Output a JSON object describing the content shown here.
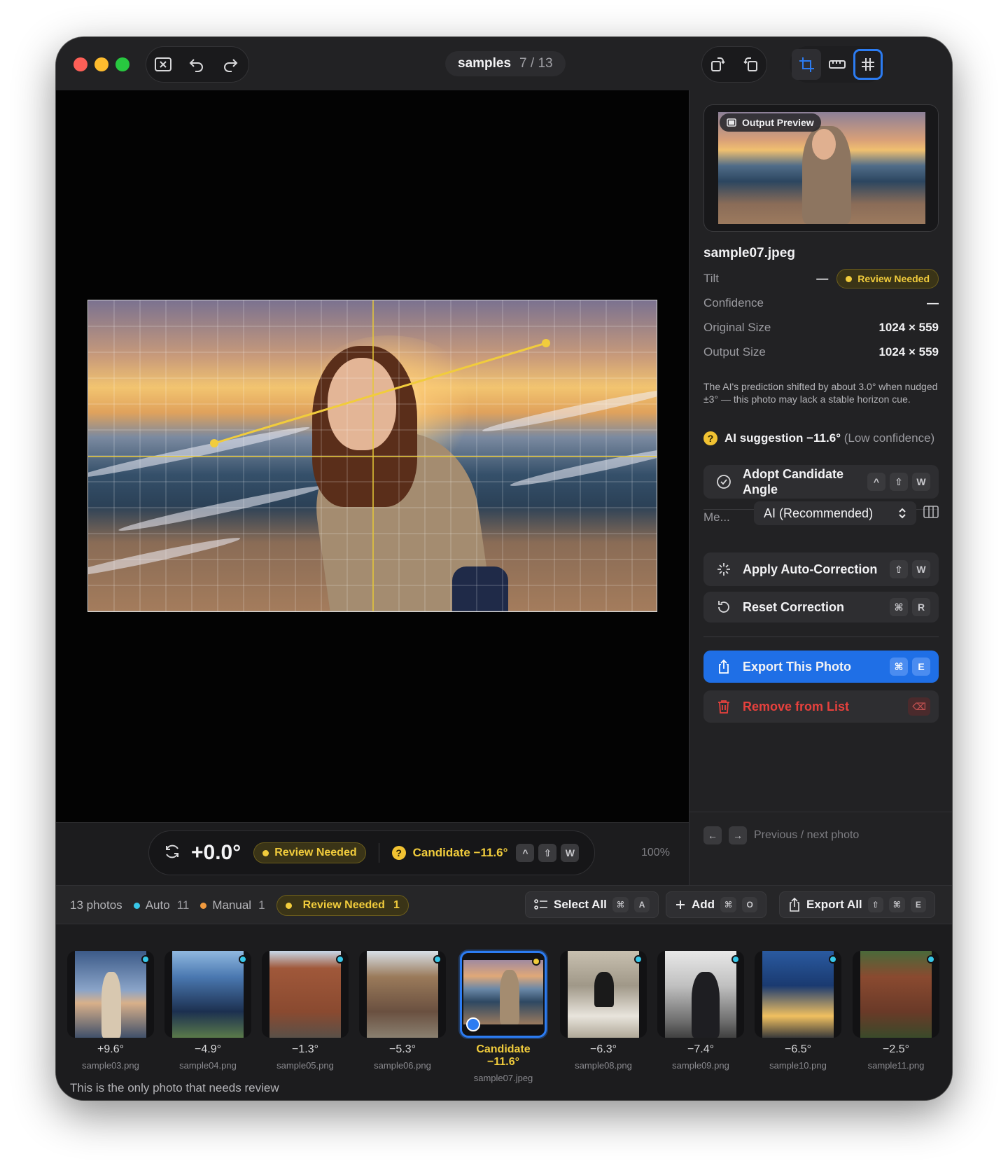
{
  "window": {
    "title": "samples",
    "counter": "7 / 13"
  },
  "canvas": {
    "angle_value": "+0.0°",
    "review_badge": "Review Needed",
    "candidate_label": "Candidate −11.6°",
    "candidate_keys": [
      "^",
      "⇧",
      "W"
    ],
    "zoom": "100%"
  },
  "side": {
    "preview_badge": "Output Preview",
    "file_name": "sample07.jpeg",
    "tilt_label": "Tilt",
    "tilt_value": "—",
    "tilt_badge": "Review Needed",
    "confidence_label": "Confidence",
    "confidence_value": "—",
    "original_size_label": "Original Size",
    "original_size_value": "1024 × 559",
    "output_size_label": "Output Size",
    "output_size_value": "1024 × 559",
    "note": "The AI's prediction shifted by about 3.0° when nudged ±3° — this photo may lack a stable horizon cue.",
    "ai_suggestion": "AI suggestion −11.6°",
    "ai_confidence": "(Low confidence)",
    "adopt_label": "Adopt Candidate Angle",
    "adopt_keys": [
      "^",
      "⇧",
      "W"
    ],
    "method_label": "Me...",
    "method_value": "AI (Recommended)",
    "apply_label": "Apply Auto-Correction",
    "apply_keys": [
      "⇧",
      "W"
    ],
    "reset_label": "Reset Correction",
    "reset_keys": [
      "⌘",
      "R"
    ],
    "export_label": "Export This Photo",
    "export_keys": [
      "⌘",
      "E"
    ],
    "remove_label": "Remove from List",
    "remove_key": "⌫",
    "nav_hint": "Previous / next photo"
  },
  "strip_bar": {
    "total": "13 photos",
    "auto_label": "Auto",
    "auto_count": "11",
    "manual_label": "Manual",
    "manual_count": "1",
    "review_label": "Review Needed",
    "review_count": "1",
    "select_all": "Select All",
    "select_all_keys": [
      "⌘",
      "A"
    ],
    "add": "Add",
    "add_keys": [
      "⌘",
      "O"
    ],
    "export_all": "Export All",
    "export_all_keys": [
      "⇧",
      "⌘",
      "E"
    ]
  },
  "thumbs": [
    {
      "angle": "+9.6°",
      "file": "sample03.png"
    },
    {
      "angle": "−4.9°",
      "file": "sample04.png"
    },
    {
      "angle": "−1.3°",
      "file": "sample05.png"
    },
    {
      "angle": "−5.3°",
      "file": "sample06.png"
    },
    {
      "angle": "Candidate −11.6°",
      "file": "sample07.jpeg"
    },
    {
      "angle": "−6.3°",
      "file": "sample08.png"
    },
    {
      "angle": "−7.4°",
      "file": "sample09.png"
    },
    {
      "angle": "−6.5°",
      "file": "sample10.png"
    },
    {
      "angle": "−2.5°",
      "file": "sample11.png"
    }
  ],
  "footer_message": "This is the only photo that needs review",
  "colors": {
    "accent": "#1f6fe6",
    "review": "#f1cc3c",
    "auto": "#38c7e8",
    "manual": "#f09a3e",
    "danger": "#e7413d"
  }
}
